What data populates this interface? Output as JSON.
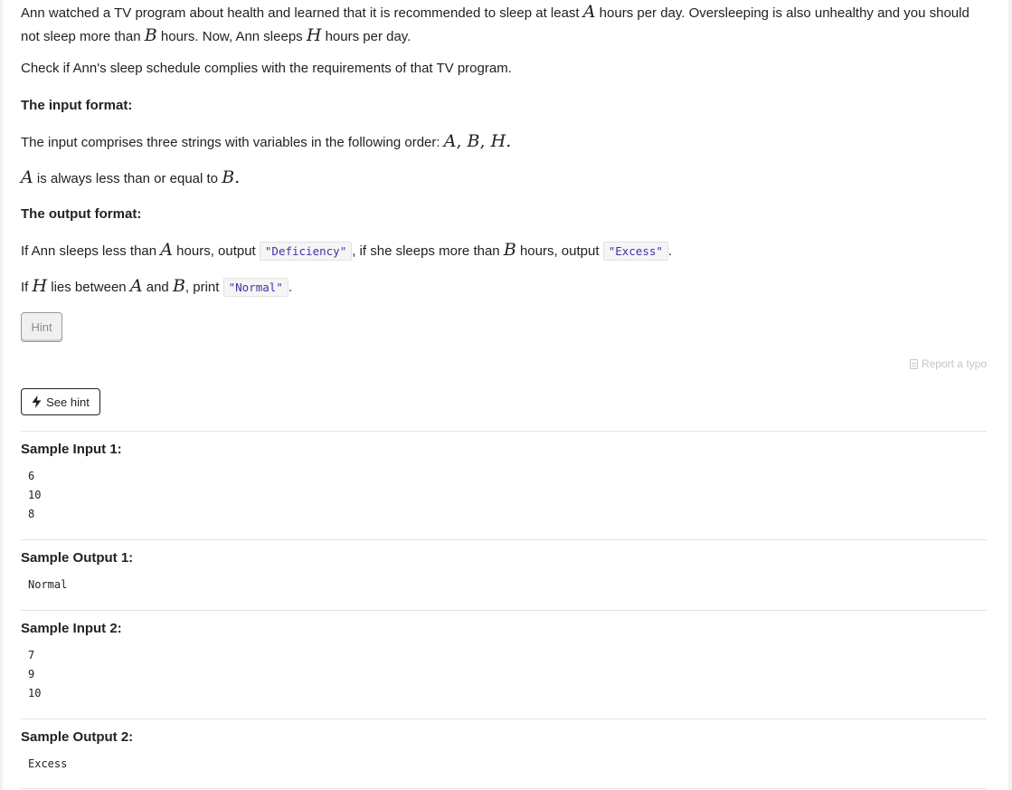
{
  "statement": {
    "p1": {
      "t1": "Ann watched a TV program about health and learned that it is recommended to sleep at least ",
      "m1": "A",
      "t2": " hours per day. Oversleeping is also unhealthy and you should not sleep more than ",
      "m2": "B",
      "t3": " hours. Now, Ann sleeps ",
      "m3": "H",
      "t4": " hours per day."
    },
    "p2": "Check if Ann's sleep schedule complies with the requirements of that TV program.",
    "input_heading": "The input format:",
    "p3": {
      "t1": "The input comprises three strings with variables in the following order: ",
      "m1": "A",
      "c1": ", ",
      "m2": "B",
      "c2": ", ",
      "m3": "H",
      "end": "."
    },
    "p4": {
      "m1": "A",
      "t1": " is always less than or equal to ",
      "m2": "B",
      "end": "."
    },
    "output_heading": "The output format:",
    "p5": {
      "t1": "If Ann sleeps less than ",
      "m1": "A",
      "t2": " hours, output ",
      "code1": "\"Deficiency\"",
      "t3": ", if she sleeps more than ",
      "m2": "B",
      "t4": " hours, output ",
      "code2": "\"Excess\"",
      "end": "."
    },
    "p6": {
      "t1": "If ",
      "m1": "H",
      "t2": " lies between ",
      "m2": "A",
      "t3": " and ",
      "m3": "B",
      "t4": ", print ",
      "code1": "\"Normal\"",
      "end": "."
    }
  },
  "hint_button_label": "Hint",
  "report_link": {
    "label": "Report a typo",
    "icon": "document-icon"
  },
  "see_hint_button": {
    "label": "See hint",
    "icon": "lightning-bolt-icon"
  },
  "samples": [
    {
      "title": "Sample Input 1:",
      "content": "6\n10\n8"
    },
    {
      "title": "Sample Output 1:",
      "content": "Normal"
    },
    {
      "title": "Sample Input 2:",
      "content": "7\n9\n10"
    },
    {
      "title": "Sample Output 2:",
      "content": "Excess"
    }
  ],
  "colors": {
    "code_text": "#4a2fa6",
    "report_link": "#c4c4c4"
  }
}
